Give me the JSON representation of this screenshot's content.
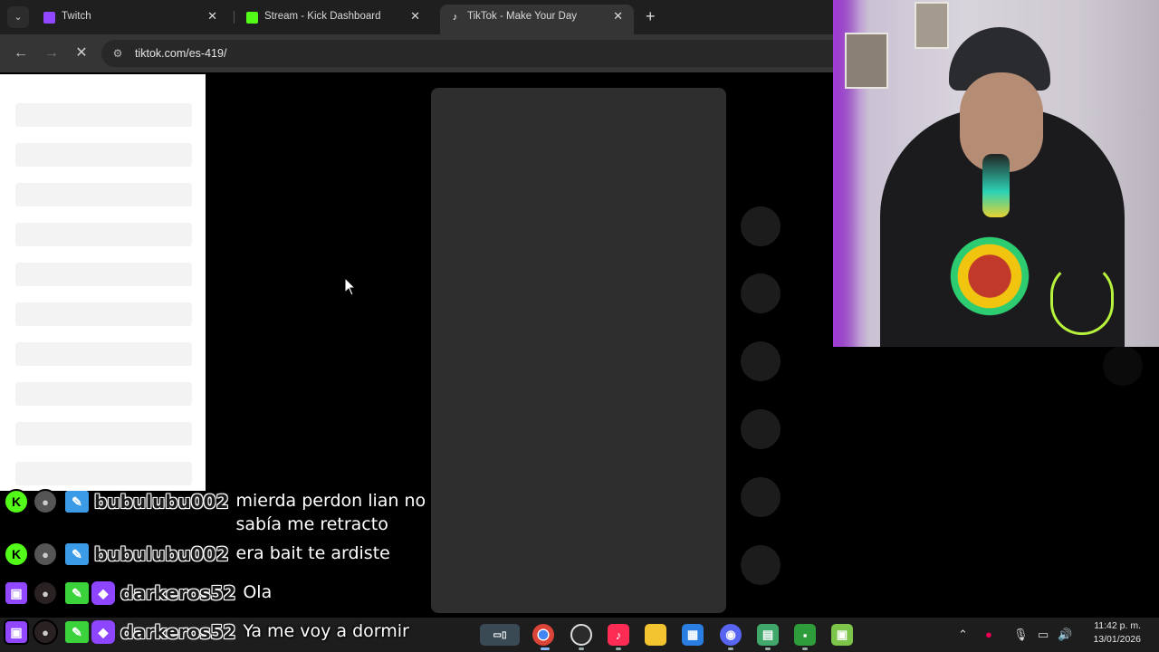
{
  "browser": {
    "tabs": [
      {
        "title": "Twitch",
        "favicon": "twitch-icon",
        "color": "#9146ff",
        "active": false
      },
      {
        "title": "Stream - Kick Dashboard",
        "favicon": "kick-icon",
        "color": "#53fc18",
        "active": false
      },
      {
        "title": "TikTok - Make Your Day",
        "favicon": "tiktok-icon",
        "color": "#ffffff",
        "active": true
      }
    ],
    "url": "tiktok.com/es-419/"
  },
  "chat": [
    {
      "platform": "kick",
      "user": "bubulubu002",
      "message_line1": "mierda perdon lian no",
      "message_line2": "sabía me retracto"
    },
    {
      "platform": "kick",
      "user": "bubulubu002",
      "message_line1": "era bait te ardiste"
    },
    {
      "platform": "twitch",
      "user": "darkeros52",
      "message_line1": "Ola"
    },
    {
      "platform": "twitch",
      "user": "darkeros52",
      "message_line1": "Ya me voy a dormir"
    }
  ],
  "taskbar": {
    "time": "11:42 p. m.",
    "date": "13/01/2026",
    "apps": [
      "twitch-icon",
      "folder-icon",
      "chrome-icon",
      "obs-icon",
      "tiktok-icon",
      "files-icon",
      "store-icon",
      "discord-icon",
      "app-icon",
      "minecraft-icon",
      "minecraft-grass-icon"
    ]
  },
  "colors": {
    "kick": "#53fc18",
    "twitch": "#9146ff",
    "tiktok": "#fe2c55"
  }
}
